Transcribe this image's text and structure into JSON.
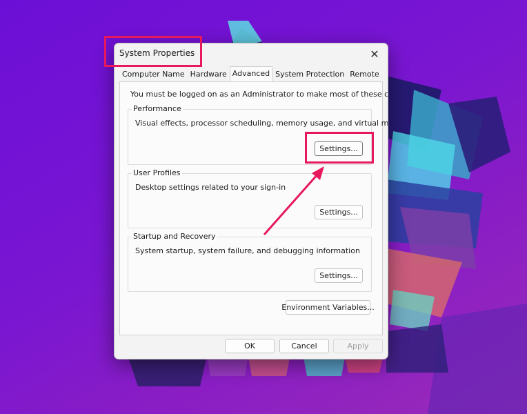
{
  "window": {
    "title": "System Properties",
    "close_glyph": "✕"
  },
  "tabs": [
    {
      "label": "Computer Name"
    },
    {
      "label": "Hardware"
    },
    {
      "label": "Advanced"
    },
    {
      "label": "System Protection"
    },
    {
      "label": "Remote"
    }
  ],
  "active_tab": "Advanced",
  "notice": "You must be logged on as an Administrator to make most of these changes.",
  "groups": {
    "performance": {
      "label": "Performance",
      "description": "Visual effects, processor scheduling, memory usage, and virtual memory",
      "button": "Settings..."
    },
    "user_profiles": {
      "label": "User Profiles",
      "description": "Desktop settings related to your sign-in",
      "button": "Settings..."
    },
    "startup_recovery": {
      "label": "Startup and Recovery",
      "description": "System startup, system failure, and debugging information",
      "button": "Settings..."
    }
  },
  "environment_button": "Environment Variables...",
  "footer": {
    "ok": "OK",
    "cancel": "Cancel",
    "apply": "Apply"
  },
  "annotation_color": "#e8185c"
}
